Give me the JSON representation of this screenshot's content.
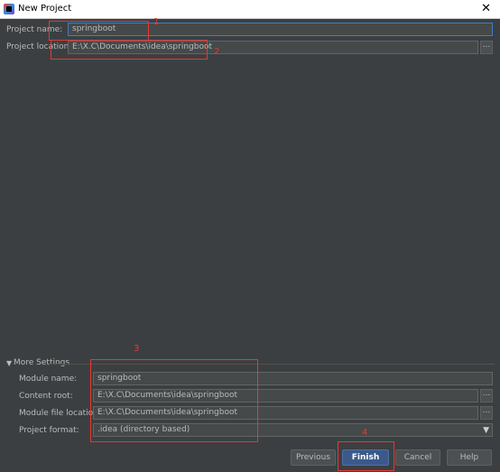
{
  "window": {
    "title": "New Project"
  },
  "project": {
    "name_label": "Project name:",
    "name_value": "springboot",
    "location_label": "Project location:",
    "location_value": "E:\\X.C\\Documents\\idea\\springboot",
    "browse_label": "..."
  },
  "more_settings": {
    "header": "More Settings",
    "module_name_label": "Module name:",
    "module_name_value": "springboot",
    "content_root_label": "Content root:",
    "content_root_value": "E:\\X.C\\Documents\\idea\\springboot",
    "module_file_location_label": "Module file location:",
    "module_file_location_value": "E:\\X.C\\Documents\\idea\\springboot",
    "project_format_label": "Project format:",
    "project_format_value": ".idea (directory based)",
    "browse_label": "..."
  },
  "annotations": [
    "1",
    "2",
    "3",
    "4"
  ],
  "buttons": {
    "previous": "Previous",
    "finish": "Finish",
    "cancel": "Cancel",
    "help": "Help"
  },
  "colors": {
    "background": "#3c3f41",
    "annotation": "#e53935",
    "default_button": "#3b5a89"
  }
}
